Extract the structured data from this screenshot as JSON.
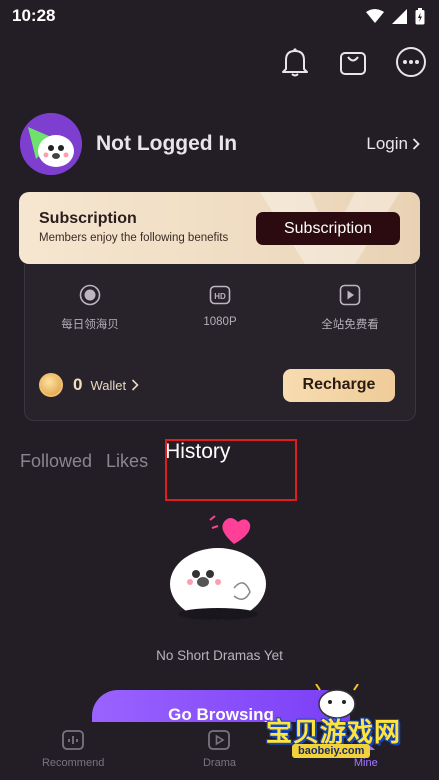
{
  "status": {
    "time": "10:28"
  },
  "profile": {
    "name": "Not Logged In",
    "login_label": "Login"
  },
  "subscription": {
    "title": "Subscription",
    "description": "Members enjoy the following benefits",
    "button_label": "Subscription"
  },
  "benefits": [
    {
      "icon": "coin-circle-icon",
      "label": "每日领海贝"
    },
    {
      "icon": "hd-icon",
      "label": "1080P"
    },
    {
      "icon": "play-square-icon",
      "label": "全站免费看"
    }
  ],
  "wallet": {
    "count": "0",
    "label": "Wallet",
    "recharge_label": "Recharge"
  },
  "tabs": [
    {
      "label": "Followed"
    },
    {
      "label": "Likes"
    },
    {
      "label": "History"
    }
  ],
  "empty": {
    "text": "No Short Dramas Yet",
    "button_label": "Go Browsing"
  },
  "nav": [
    {
      "label": "Recommend",
      "icon": "recommend-icon"
    },
    {
      "label": "Drama",
      "icon": "drama-play-icon"
    },
    {
      "label": "Mine",
      "icon": "mine-icon"
    }
  ],
  "watermark": {
    "text": "宝贝游戏网",
    "url": "baobeiy.com"
  },
  "colors": {
    "accent": "#8b55fb",
    "highlight": "#e01d1d",
    "background": "#231e26"
  }
}
